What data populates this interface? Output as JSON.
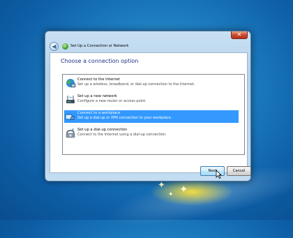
{
  "window": {
    "title": "Set Up a Connection or Network",
    "close_label": "✕"
  },
  "content": {
    "heading": "Choose a connection option"
  },
  "options": [
    {
      "title": "Connect to the Internet",
      "description": "Set up a wireless, broadband, or dial-up connection to the Internet.",
      "icon": "internet-globe-icon",
      "selected": false
    },
    {
      "title": "Set up a new network",
      "description": "Configure a new router or access point.",
      "icon": "router-icon",
      "selected": false
    },
    {
      "title": "Connect to a workplace",
      "description": "Set up a dial-up or VPN connection to your workplace.",
      "icon": "workplace-vpn-icon",
      "selected": true
    },
    {
      "title": "Set up a dial-up connection",
      "description": "Connect to the Internet using a dial-up connection.",
      "icon": "dialup-phone-icon",
      "selected": false
    }
  ],
  "buttons": {
    "next": "Next",
    "cancel": "Cancel"
  },
  "colors": {
    "selection": "#3399ff",
    "heading": "#1e3287",
    "desktop": "#1f7fc1"
  }
}
